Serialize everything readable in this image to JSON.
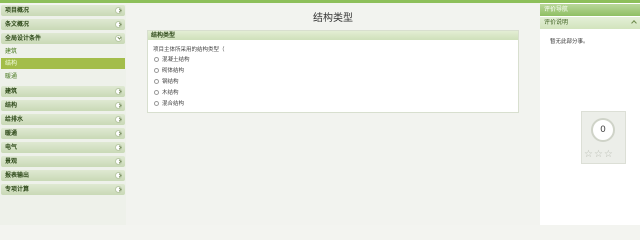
{
  "sidebar": {
    "items": [
      {
        "label": "项目概况",
        "expanded": false
      },
      {
        "label": "条文概况",
        "expanded": false
      },
      {
        "label": "全局设计条件",
        "expanded": true
      }
    ],
    "subitems": [
      "建筑",
      "结构",
      "暖通"
    ],
    "active_subitem": "结构",
    "items_after": [
      "建筑",
      "结构",
      "给排水",
      "暖通",
      "电气",
      "景观",
      "报表输出",
      "专项计算"
    ]
  },
  "main": {
    "title": "结构类型",
    "panel_header": "结构类型",
    "question": "项目主体所采用的结构类型（",
    "options": [
      "混凝土结构",
      "砌体结构",
      "钢结构",
      "木结构",
      "混合结构"
    ]
  },
  "right": {
    "nav_title": "评价导航",
    "section_title": "评价说明",
    "description": "暂无此部分事。",
    "score": "0",
    "stars": "☆☆☆"
  },
  "colors": {
    "accent": "#8dbf5a",
    "active_item": "#a3bd4a"
  }
}
